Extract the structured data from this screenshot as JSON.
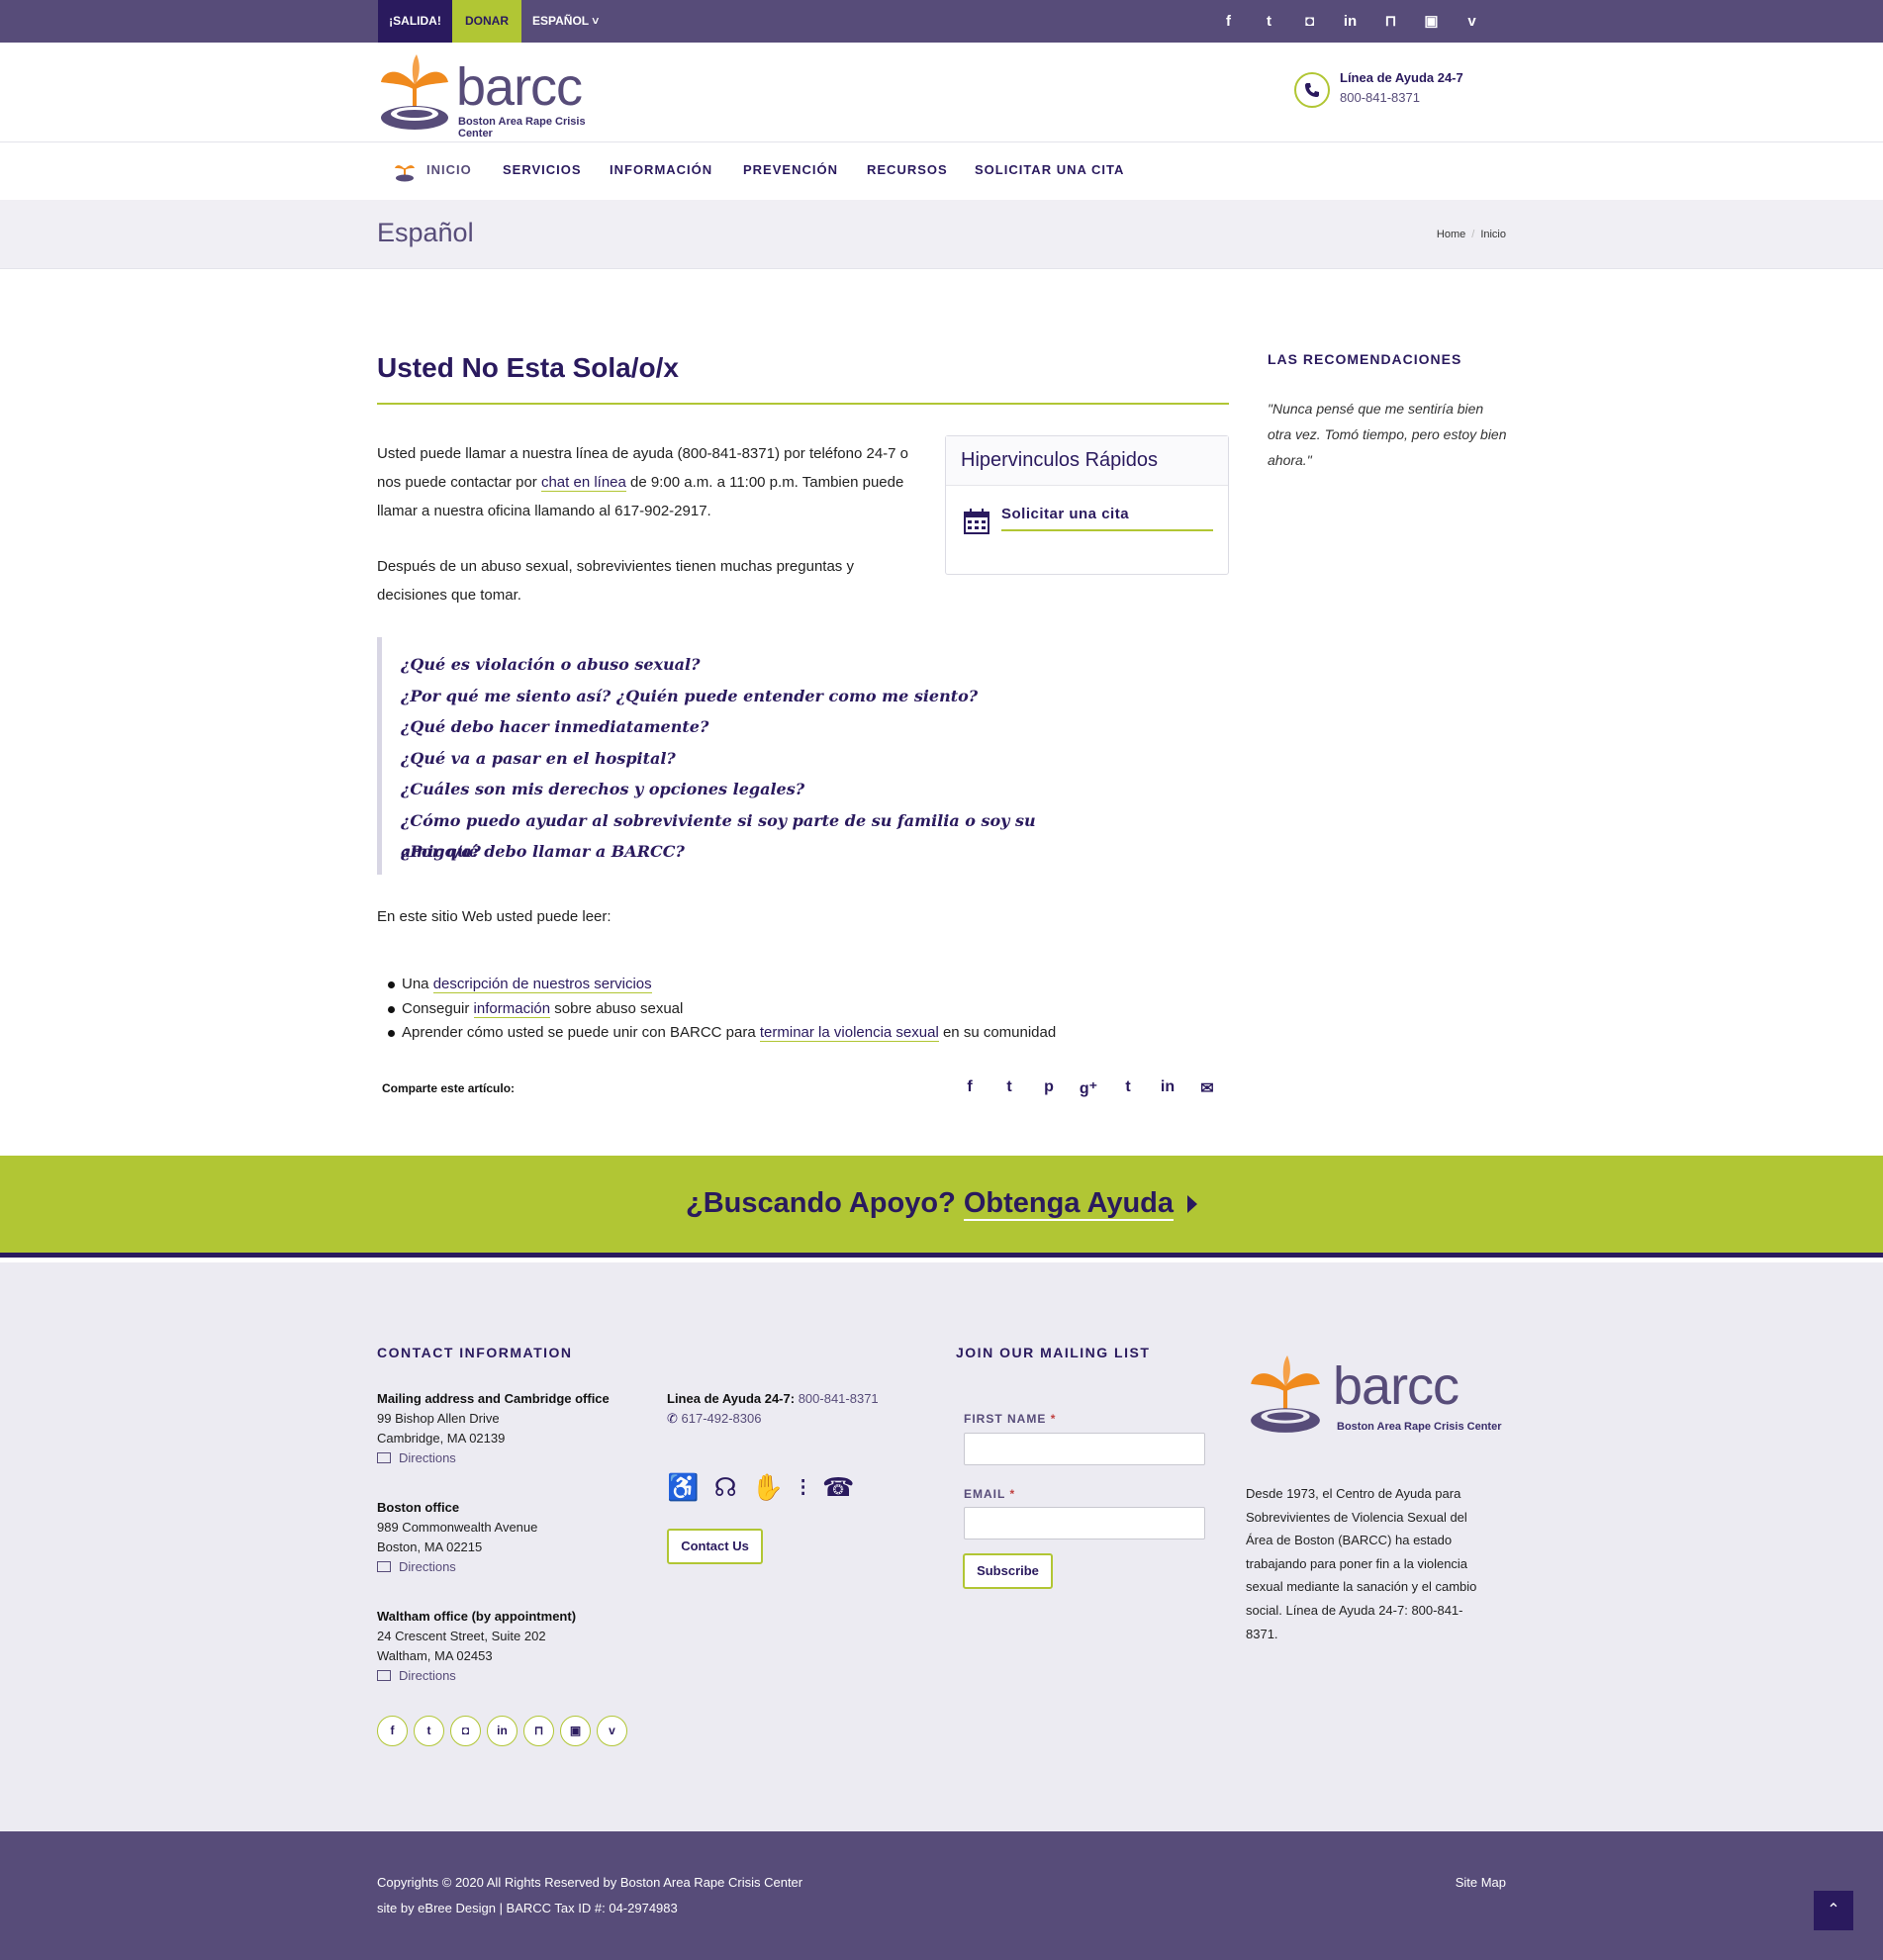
{
  "topbar": {
    "exit_label": "¡SALIDA!",
    "donate_label": "DONAR",
    "language_label": "ESPAÑOL",
    "social_icons": [
      "facebook-icon",
      "twitter-icon",
      "instagram-icon",
      "linkedin-icon",
      "bookmark-icon",
      "youtube-icon",
      "vimeo-icon"
    ],
    "social_glyphs": [
      "f",
      "t",
      "◘",
      "in",
      "⊓",
      "▣",
      "v"
    ]
  },
  "header": {
    "logo_word": "barcc",
    "logo_sub": "Boston Area Rape Crisis Center",
    "helpline_label": "Línea de Ayuda 24-7",
    "helpline_number": "800-841-8371"
  },
  "nav": {
    "items": [
      "INICIO",
      "SERVICIOS",
      "INFORMACIÓN",
      "PREVENCIÓN",
      "RECURSOS",
      "SOLICITAR UNA CITA"
    ]
  },
  "titlebar": {
    "title": "Español",
    "breadcrumb": [
      "Home",
      "Inicio"
    ]
  },
  "main": {
    "title": "Usted No Esta Sola/o/x",
    "intro_1a": "Usted puede llamar a nuestra línea de ayuda (800-841-8371) por teléfono 24-7 o nos puede contactar por ",
    "intro_1_link": "chat en línea",
    "intro_1b": " de 9:00 a.m. a 11:00 p.m. Tambien puede llamar a nuestra oficina llamando al 617-902-2917.",
    "intro_2": "Después de un abuso sexual, sobrevivientes tienen muchas preguntas y decisiones que tomar.",
    "quick_links": {
      "title": "Hipervinculos Rápidos",
      "item": "Solicitar una cita"
    },
    "questions": [
      "¿Qué es violación o abuso sexual?",
      "¿Por qué me siento así? ¿Quién puede entender como me siento?",
      "¿Qué debo hacer inmediatamente?",
      "¿Qué va a pasar en el hospital?",
      "¿Cuáles son mis derechos y opciones legales?",
      "¿Cómo puedo ayudar al sobreviviente si soy parte de su familia o soy su amigo/a?",
      "¿Por qué debo llamar a BARCC?"
    ],
    "read_label": "En este sitio Web usted puede leer:",
    "bullets": [
      {
        "before": "Una ",
        "link": "descripción de nuestros servicios",
        "after": ""
      },
      {
        "before": "Conseguir ",
        "link": "información",
        "after": " sobre abuso sexual"
      },
      {
        "before": "Aprender cómo usted se puede unir con BARCC para ",
        "link": "terminar la violencia sexual",
        "after": " en su comunidad"
      }
    ],
    "share_label": "Comparte este artículo:",
    "share_glyphs": [
      "f",
      "t",
      "p",
      "g⁺",
      "t",
      "in",
      "✉"
    ]
  },
  "sidebar": {
    "title": "LAS RECOMENDACIONES",
    "quote": "\"Nunca pensé que me sentiría bien otra vez. Tomó tiempo, pero estoy bien ahora.\""
  },
  "cta": {
    "prefix": "¿Buscando Apoyo? ",
    "link": "Obtenga Ayuda"
  },
  "footer": {
    "contact_title": "CONTACT INFORMATION",
    "offices": [
      {
        "name": "Mailing address and Cambridge office",
        "line1": "99 Bishop Allen Drive",
        "line2": "Cambridge, MA 02139",
        "directions": "Directions"
      },
      {
        "name": "Boston office",
        "line1": "989 Commonwealth Avenue",
        "line2": "Boston, MA 02215",
        "directions": "Directions"
      },
      {
        "name": "Waltham office (by appointment)",
        "line1": "24 Crescent Street, Suite 202",
        "line2": "Waltham, MA 02453",
        "directions": "Directions"
      }
    ],
    "helpline_label": "Linea de Ayuda 24-7:",
    "helpline_number": "800-841-8371",
    "office_phone": "617-492-8306",
    "access_icons": "♿ ☊ ✋ ⁝ ☎",
    "contact_button": "Contact Us",
    "mailing_title": "JOIN OUR MAILING LIST",
    "first_name_label": "FIRST NAME",
    "email_label": "EMAIL",
    "required_mark": "*",
    "subscribe_button": "Subscribe",
    "logo_word": "barcc",
    "logo_sub": "Boston Area Rape Crisis Center",
    "about": "Desde 1973, el Centro de Ayuda para Sobrevivientes de Violencia Sexual del Área de Boston (BARCC) ha estado trabajando para poner fin a la violencia sexual mediante la sanación y el cambio social. Línea de Ayuda 24-7: 800-841-8371.",
    "social_glyphs": [
      "f",
      "t",
      "◘",
      "in",
      "⊓",
      "▣",
      "v"
    ]
  },
  "bottom": {
    "copyright": "Copyrights © 2020 All Rights Reserved by Boston Area Rape Crisis Center",
    "credit": "site by eBree Design  |  BARCC Tax ID #: 04-2974983",
    "sitemap": "Site Map",
    "totop_glyph": "⌃"
  },
  "colors": {
    "purple_dark": "#2a1a5e",
    "purple": "#574c79",
    "lime": "#b1c634",
    "orange": "#f08a1d"
  }
}
